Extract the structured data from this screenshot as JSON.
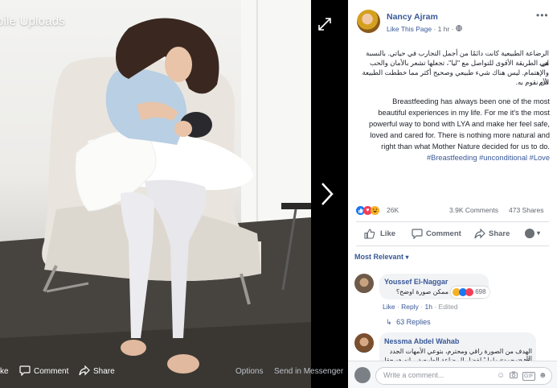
{
  "viewer": {
    "album_title": "bile Uploads",
    "actions": {
      "like": "ke",
      "comment": "Comment",
      "share": "Share",
      "options": "Options",
      "send": "Send in Messenger"
    }
  },
  "post": {
    "page_name": "Nancy Ajram",
    "like_this_page": "Like This Page",
    "dot": "·",
    "time": "1 hr",
    "arabic_text": [
      "الرضاعة الطبيعية كانت دائمًا من أجمل التجارب في حياتي. بالنسبة لي،",
      "هي الطريقة الأقوى للتواصل مع \"ليا\"، تجعلها تشعر بالأمان والحب",
      "والإهتمام. ليس هناك شيء طبيعي وصحيح أكثر مما خططت الطبيعة الأم",
      "لأن نقوم به."
    ],
    "english_text": "Breastfeeding has always been one of the most beautiful experiences in my life. For me it's the most powerful way to bond with LYA and make her feel safe, loved and cared for. There is nothing more natural and right than what Mother Nature decided for us to do.",
    "hashtags": [
      "#Breastfeeding",
      "#unconditional",
      "#Love"
    ],
    "reactions_count": "26K",
    "comments_count": "3.9K Comments",
    "shares_count": "473 Shares",
    "actions": {
      "like": "Like",
      "comment": "Comment",
      "share": "Share"
    }
  },
  "comments": {
    "sort": "Most Relevant",
    "items": [
      {
        "name": "Youssef El-Naggar",
        "text": "ممكن صورة اوضح؟",
        "reaction_count": "698",
        "like": "Like",
        "reply": "Reply",
        "time": "1h",
        "edited": "Edited",
        "replies": "63 Replies"
      },
      {
        "name": "Nessma Abdel Wahab",
        "text_lines": [
          "الهدف من الصورة راقي ومحترم، بتوعي الأمهات الجدد اللي",
          "بقر «محمد» ماما ” لفضل ال ضاعة الطبيعية .. انه هو حقا"
        ]
      }
    ],
    "composer_placeholder": "Write a comment..."
  },
  "colors": {
    "link": "#385898",
    "like_blue": "#1877f2",
    "love_red": "#f33e58",
    "haha_yellow": "#f7b125"
  },
  "icons": [
    "expand-icon",
    "next-arrow-icon",
    "more-options-icon",
    "globe-icon",
    "like-icon",
    "comment-icon",
    "share-icon",
    "emoji-icon",
    "camera-icon",
    "gif-icon",
    "sticker-icon",
    "chevron-down-icon"
  ]
}
